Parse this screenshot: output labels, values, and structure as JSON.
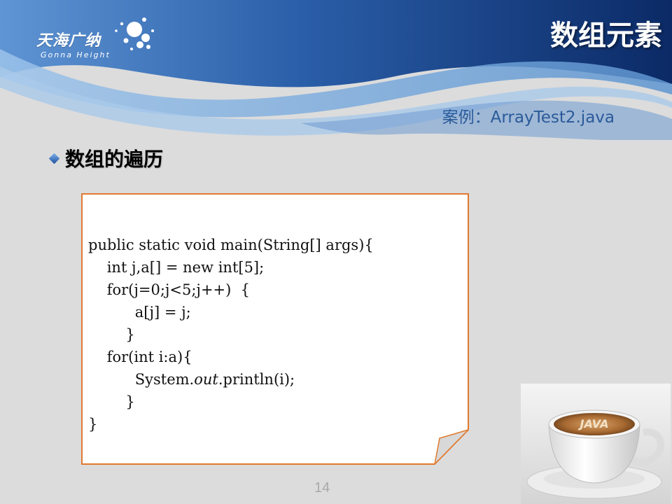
{
  "header": {
    "logo_cn": "天海广纳",
    "logo_en": "Gonna Height",
    "title": "数组元素"
  },
  "case_label": "案例：ArrayTest2.java",
  "bullet": {
    "icon": "diamond-icon",
    "text": "数组的遍历"
  },
  "code": {
    "line1": "public static void main(String[] args){",
    "line2": "    int j,a[] = new int[5];",
    "line3": "    for(j=0;j<5;j++)  {",
    "line4": "          a[j] = j;",
    "line5": "        }",
    "line6": "    for(int i:a){",
    "line7_prefix": "          System.",
    "line7_italic": "out",
    "line7_suffix": ".println(i);",
    "line8": "        }",
    "line9": "}"
  },
  "page_number": "14",
  "image": {
    "cup_text": "JAVA"
  },
  "colors": {
    "header_dark": "#0d2f6e",
    "header_light": "#4f86c6",
    "box_border": "#e07a2e",
    "case_label": "#2a5a9a"
  }
}
